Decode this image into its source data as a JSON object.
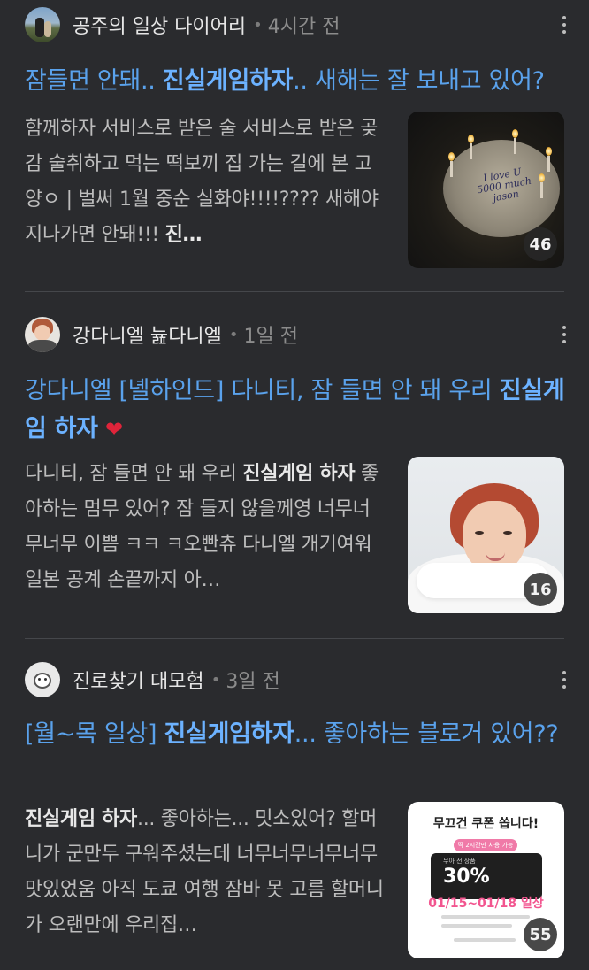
{
  "posts": [
    {
      "author": "공주의 일상 다이어리",
      "time": "4시간 전",
      "title": {
        "pre": "잠들면 안돼.. ",
        "bold": "진실게임하자",
        "post": ".. 새해는 잘 보내고 있어?"
      },
      "snippet": {
        "text": "함께하자 서비스로 받은 술 서비스로 받은 곶감 술취하고 먹는 떡보끼 집 가는 길에 본 고양ㅇ |  벌써 1월 중순 실화야!!!!???? 새해야 지나가면 안돼!!! ",
        "bold_tail": "진…"
      },
      "image_count": "46",
      "thumb_text": "I love U\n5000 much\njason"
    },
    {
      "author": "강다니엘 늂다니엘",
      "time": "1일 전",
      "title": {
        "pre": "강다니엘 [녤하인드] 다니티, 잠 들면 안 돼 우리 ",
        "bold": "진실게임 하자",
        "post": " "
      },
      "snippet": {
        "pre": "다니티, 잠 들면 안 돼 우리 ",
        "bold": "진실게임 하자",
        "post": " 좋아하는 멈무 있어? 잠 들지 않을께영 너무너무너무 이쁨 ㅋㅋ ㅋ오빤츄 다니엘 개기여워 일본 공계 손끝까지 아…"
      },
      "image_count": "16"
    },
    {
      "author": "진로찾기 대모험",
      "time": "3일 전",
      "title": {
        "pre": "[월~목 일상] ",
        "bold": "진실게임하자",
        "post": "... 좋아하는 블로거 있어??"
      },
      "snippet": {
        "bold": "진실게임 하자",
        "post": "... 좋아하는... 밋소있어? 할머니가 군만두 구워주셨는데 너무너무너무너무 맛있었움 아직 도쿄 여행 잠바 못 고름 할머니가 오랜만에 우리집…"
      },
      "image_count": "55",
      "coupon": {
        "title": "무끄건 쿠폰 쏩니다!",
        "pill": "딱 2시간만 사용 가능",
        "pct_label": "무아 전 상품",
        "pct": "30%",
        "date": "01/15~01/18 일상"
      }
    }
  ],
  "colors": {
    "background": "#2a2b2e",
    "title_link": "#5aa2ec",
    "heart": "#e0243a"
  }
}
